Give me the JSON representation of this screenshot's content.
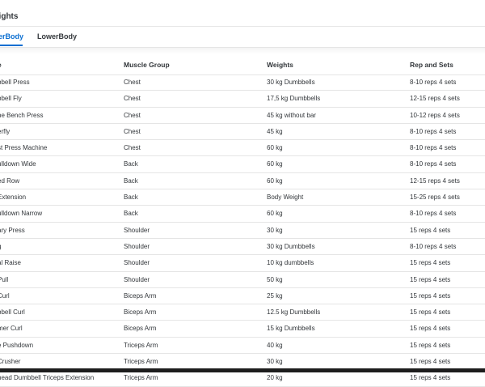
{
  "header": {
    "title": "eights"
  },
  "tabs": [
    {
      "label": "erBody",
      "active": true
    },
    {
      "label": "LowerBody",
      "active": false
    }
  ],
  "columns": [
    "e",
    "Muscle Group",
    "Weights",
    "Rep and Sets"
  ],
  "rows": [
    [
      "bbell Press",
      "Chest",
      "30 kg Dumbbells",
      "8-10 reps 4 sets"
    ],
    [
      "bbell Fly",
      "Chest",
      "17,5 kg Dumbbells",
      "12-15 reps 4 sets"
    ],
    [
      "ne Bench Press",
      "Chest",
      "45 kg without bar",
      "10-12 reps 4 sets"
    ],
    [
      "erfly",
      "Chest",
      "45 kg",
      "8-10 reps 4 sets"
    ],
    [
      "st Press Machine",
      "Chest",
      "60 kg",
      "8-10 reps 4 sets"
    ],
    [
      "ulldown Wide",
      "Back",
      "60 kg",
      "8-10 reps 4 sets"
    ],
    [
      "ed Row",
      "Back",
      "60 kg",
      "12-15 reps 4 sets"
    ],
    [
      "Extension",
      "Back",
      "Body Weight",
      "15-25 reps 4 sets"
    ],
    [
      "ulldown Narrow",
      "Back",
      "60 kg",
      "8-10 reps 4 sets"
    ],
    [
      "ary Press",
      "Shoulder",
      "30 kg",
      "15 reps 4 sets"
    ],
    [
      "g",
      "Shoulder",
      "30 kg Dumbbells",
      "8-10 reps 4 sets"
    ],
    [
      "al Raise",
      "Shoulder",
      "10 kg dumbbells",
      "15 reps 4 sets"
    ],
    [
      "Pull",
      "Shoulder",
      "50 kg",
      "15 reps 4 sets"
    ],
    [
      "Curl",
      "Biceps Arm",
      "25 kg",
      "15 reps 4 sets"
    ],
    [
      "bbell Curl",
      "Biceps Arm",
      "12.5 kg Dumbbells",
      "15 reps 4 sets"
    ],
    [
      "mer Curl",
      "Biceps Arm",
      "15 kg Dumbbells",
      "15 reps 4 sets"
    ],
    [
      "e Pushdown",
      "Triceps Arm",
      "40 kg",
      "15 reps 4 sets"
    ],
    [
      "Crusher",
      "Triceps Arm",
      "30 kg",
      "15 reps 4 sets"
    ],
    [
      "head Dumbbell Triceps Extension",
      "Triceps Arm",
      "20 kg",
      "15 reps 4 sets"
    ]
  ],
  "colors": {
    "accent": "#0a6ed1",
    "text": "#32363a",
    "border": "#e5e5e5"
  }
}
